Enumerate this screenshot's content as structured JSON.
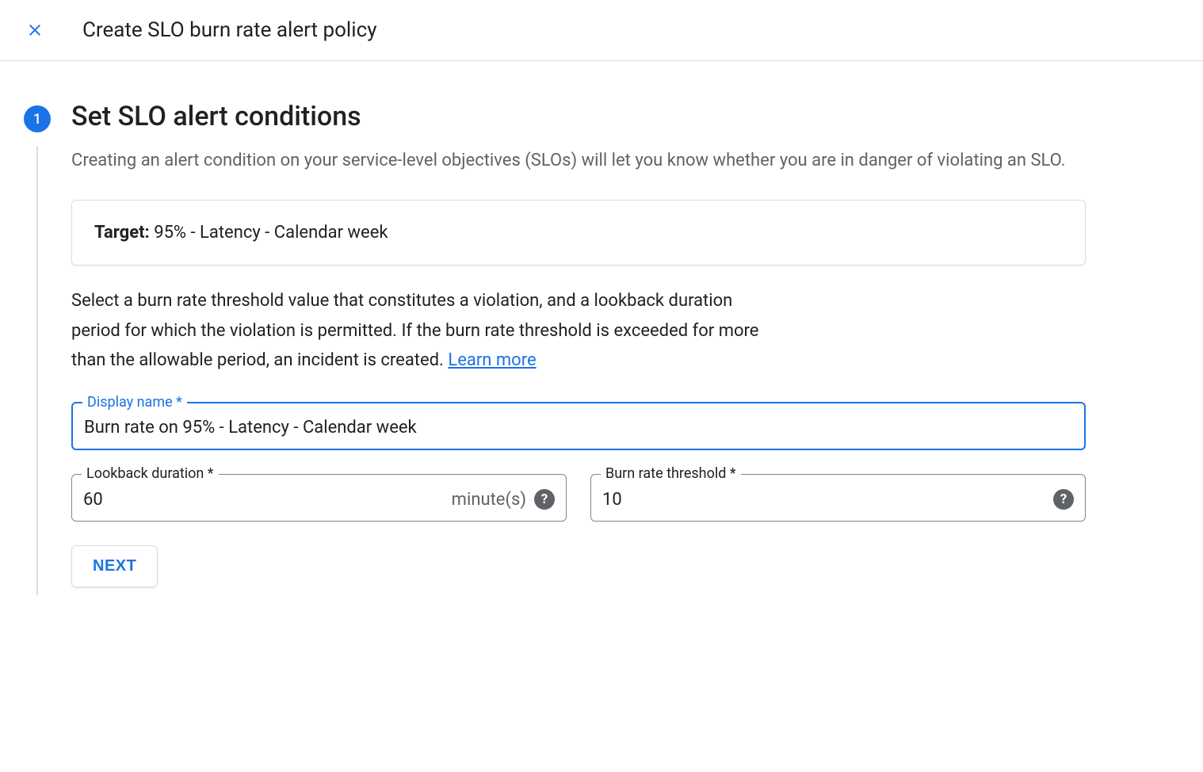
{
  "header": {
    "title": "Create SLO burn rate alert policy"
  },
  "step": {
    "number": "1",
    "title": "Set SLO alert conditions",
    "description": "Creating an alert condition on your service-level objectives (SLOs) will let you know whether you are in danger of violating an SLO.",
    "target_label": "Target:",
    "target_value": " 95% - Latency - Calendar week",
    "instruction": "Select a burn rate threshold value that constitutes a violation, and a lookback duration period for which the violation is permitted. If the burn rate threshold is exceeded for more than the allowable period, an incident is created. ",
    "learn_more": "Learn more"
  },
  "fields": {
    "display_name": {
      "label": "Display name *",
      "value": "Burn rate on 95% - Latency - Calendar week"
    },
    "lookback": {
      "label": "Lookback duration *",
      "value": "60",
      "suffix": "minute(s)"
    },
    "threshold": {
      "label": "Burn rate threshold *",
      "value": "10"
    }
  },
  "buttons": {
    "next": "NEXT"
  }
}
